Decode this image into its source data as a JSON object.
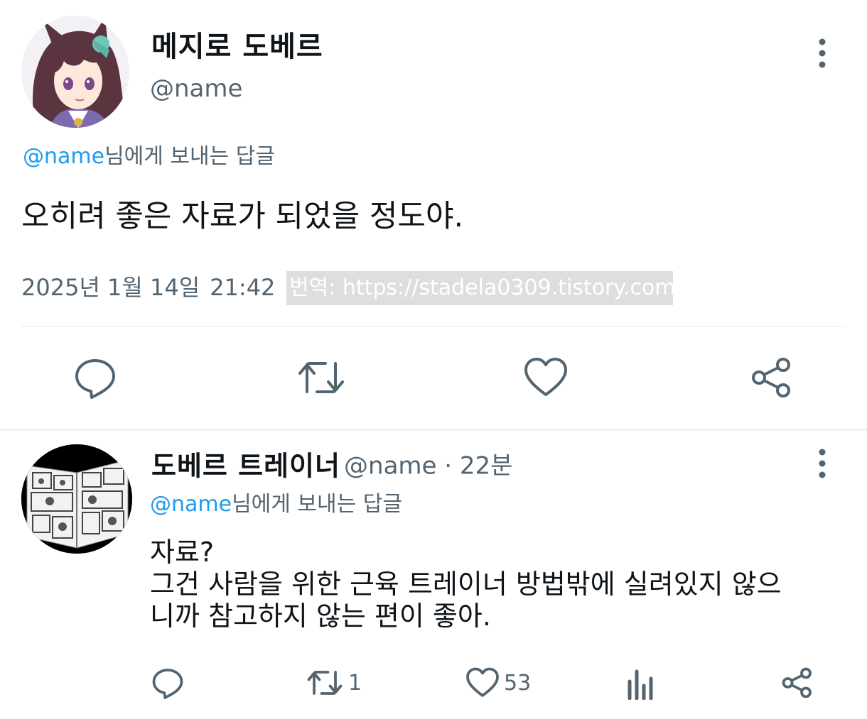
{
  "main_tweet": {
    "display_name": "메지로 도베르",
    "handle": "@name",
    "reply_to_handle": "@name",
    "reply_to_suffix": "님에게 보내는 답글",
    "text": "오히려 좋은 자료가 되었을 정도야.",
    "date": "2025년 1월 14일",
    "time": "21:42",
    "watermark": "번역: https://stadela0309.tistory.com",
    "actions": {
      "reply_icon": "reply-icon",
      "retweet_icon": "retweet-icon",
      "like_icon": "heart-icon",
      "share_icon": "share-icon"
    }
  },
  "reply_tweet": {
    "display_name": "도베르 트레이너",
    "handle": "@name",
    "separator": "·",
    "time_ago": "22분",
    "reply_to_handle": "@name",
    "reply_to_suffix": "님에게 보내는 답글",
    "text_lines": [
      "자료?",
      "그건 사람을 위한 근육 트레이너 방법밖에 실려있지 않으",
      "니까 참고하지 않는 편이 좋아."
    ],
    "stats": {
      "retweets": "1",
      "likes": "53"
    },
    "actions": {
      "reply_icon": "reply-icon",
      "retweet_icon": "retweet-icon",
      "like_icon": "heart-icon",
      "views_icon": "views-icon",
      "share_icon": "share-icon"
    }
  },
  "colors": {
    "text": "#0f1419",
    "secondary": "#536471",
    "link": "#1d9bf0",
    "divider": "#eff3f4",
    "watermark_bg": "#dedede"
  }
}
